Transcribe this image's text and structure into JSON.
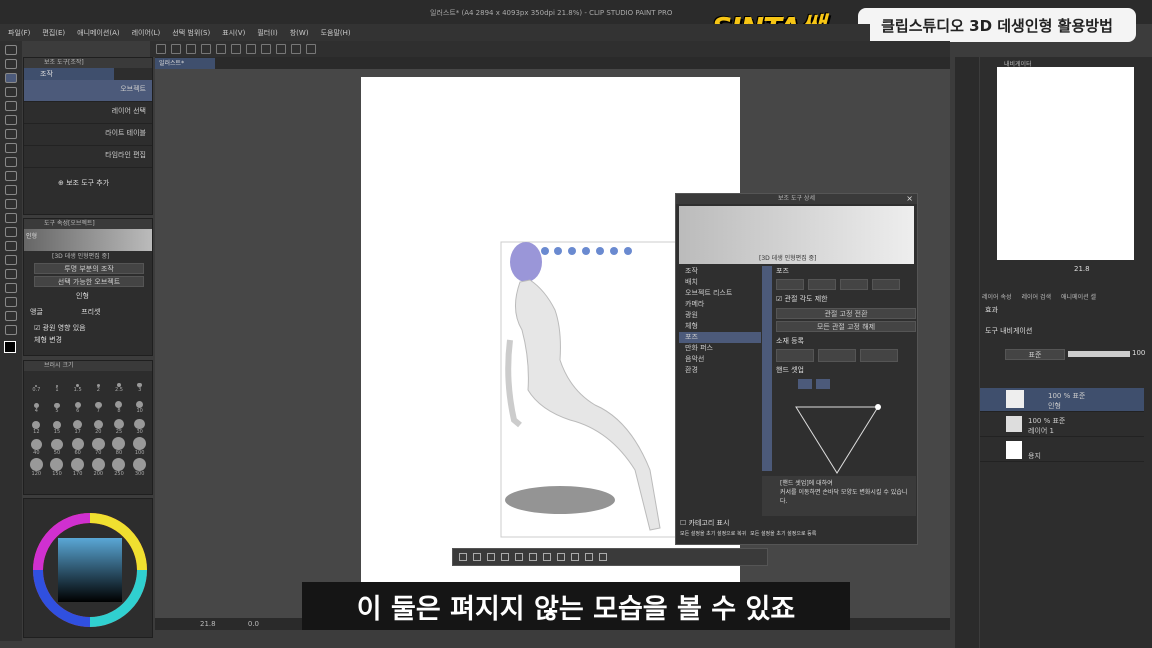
{
  "window": {
    "title": "일러스트* (A4 2894 x 4093px 350dpi 21.8%) - CLIP STUDIO PAINT PRO"
  },
  "overlay": {
    "brand": "SINTA쌤",
    "badge": "클립스튜디오 3D 데생인형 활용방법",
    "subtitle": "이 둘은 펴지지 않는 모습을 볼 수 있죠"
  },
  "menu": [
    "파일(F)",
    "편집(E)",
    "애니메이션(A)",
    "레이어(L)",
    "선택 범위(S)",
    "표시(V)",
    "필터(I)",
    "창(W)",
    "도움말(H)"
  ],
  "canvas_tab": "일러스트*",
  "subtool_panel": {
    "title": "보조 도구[조작]",
    "tab": "조작",
    "items": [
      "오브젝트",
      "레이어 선택",
      "라이트 테이블",
      "타임라인 편집"
    ],
    "add": "보조 도구 추가"
  },
  "tool_property": {
    "title": "도구 속성[오브젝트]",
    "header": "인형",
    "status": "[3D 데생 인형편집 중]",
    "opacity_mode": "투명 부분의 조작",
    "select_mode": "선택 가능한 오브젝트",
    "layer_label": "인형",
    "angle_label": "앵글",
    "preset_label": "프리셋",
    "light_effect": "광원 영향 있음",
    "body_shape": "체형 변경"
  },
  "brush_size": {
    "title": "브러시 크기",
    "values": [
      "0.7",
      "1",
      "1.5",
      "2",
      "2.5",
      "3",
      "4",
      "5",
      "6",
      "7",
      "8",
      "10",
      "12",
      "15",
      "17",
      "20",
      "25",
      "30",
      "40",
      "50",
      "60",
      "70",
      "80",
      "100",
      "120",
      "150",
      "170",
      "200",
      "250",
      "300"
    ]
  },
  "zoom": {
    "canvas": "21.8",
    "angle": "0.0",
    "nav": "21.8"
  },
  "dialog": {
    "title": "보조 도구 상세",
    "status": "[3D 데생 인형편집 중]",
    "categories": [
      "조작",
      "배치",
      "오브젝트 리스트",
      "카메라",
      "광원",
      "체형",
      "포즈",
      "만화 퍼스",
      "음악선",
      "환경"
    ],
    "selected_category": "포즈",
    "section_pose": "포즈",
    "fix_joint_angle": "관절 각도 제한",
    "joint_fix_toggle": "관절 고정 전환",
    "release_all": "모든 관절 고정 해제",
    "material_register": "소재 등록",
    "hand_setup": "핸드 셋업",
    "info_title": "[핸드 셋업]에 대하여",
    "info_text": "커서를 이동하면 손바닥 모양도 변화시킬 수 있습니다.",
    "show_category": "카테고리 표시",
    "reset_all": "모든 설정을 초기 설정으로 복귀",
    "register_all": "모든 설정을 초기 설정으로 등록"
  },
  "navigator": {
    "title": "내비게이터"
  },
  "layer_property": {
    "title": "레이어 속성",
    "tab2": "레이어 검색",
    "tab3": "애니메이션 셀",
    "effect_label": "효과",
    "tool_navi": "도구 내비게이션"
  },
  "layer_panel": {
    "blend_mode": "표준",
    "opacity": "100",
    "layers": [
      {
        "info": "100 % 표준",
        "name": "인형"
      },
      {
        "info": "100 % 표준",
        "name": "레이어 1"
      },
      {
        "info": "",
        "name": "용지"
      }
    ]
  },
  "colors": {
    "accent": "#4c5a7a",
    "brand_yellow": "#f6c515",
    "selected_layer": "#3f4f6d"
  }
}
